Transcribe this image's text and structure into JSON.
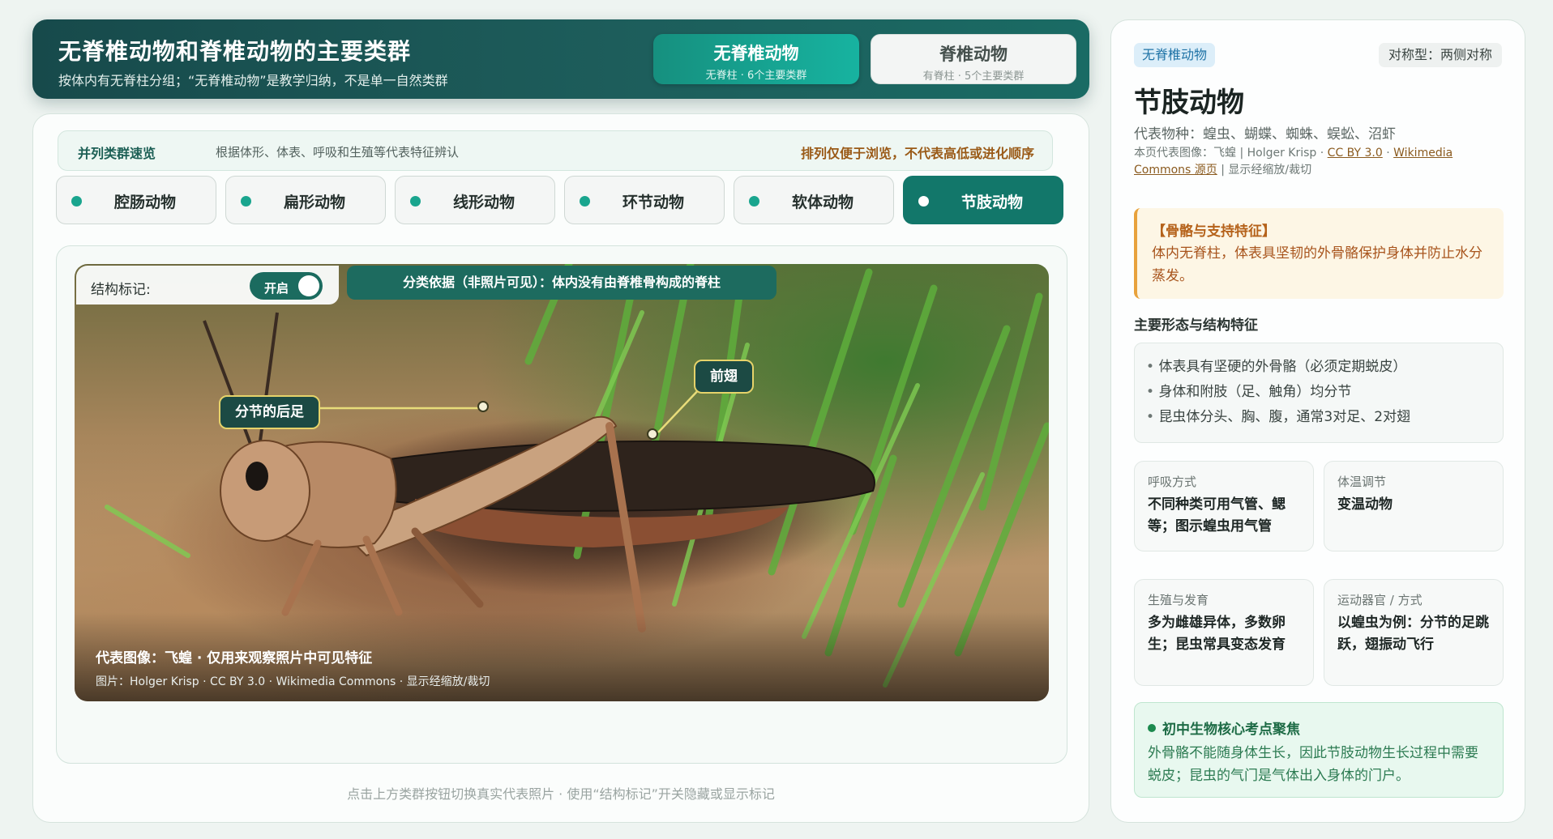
{
  "header": {
    "title": "无脊椎动物和脊椎动物的主要类群",
    "subtitle": "按体内有无脊柱分组；“无脊椎动物”是教学归纳，不是单一自然类群",
    "segments": [
      {
        "label": "无脊椎动物",
        "sub": "无脊柱 · 6个主要类群",
        "active": true
      },
      {
        "label": "脊椎动物",
        "sub": "有脊柱 · 5个主要类群",
        "active": false
      }
    ]
  },
  "overview": {
    "title": "并列类群速览",
    "desc": "根据体形、体表、呼吸和生殖等代表特征辨认",
    "note": "排列仅便于浏览，不代表高低或进化顺序"
  },
  "tabs": [
    {
      "label": "腔肠动物",
      "active": false
    },
    {
      "label": "扁形动物",
      "active": false
    },
    {
      "label": "线形动物",
      "active": false
    },
    {
      "label": "环节动物",
      "active": false
    },
    {
      "label": "软体动物",
      "active": false
    },
    {
      "label": "节肢动物",
      "active": true
    }
  ],
  "photo": {
    "toggle_label": "结构标记:",
    "toggle_state": "开启",
    "basis": "分类依据（非照片可见）：体内没有由脊椎骨构成的脊柱",
    "callouts": {
      "hind_leg": "分节的后足",
      "forewing": "前翅"
    },
    "caption_title": "代表图像：飞蝗 · 仅用来观察照片中可见特征",
    "caption_credit": "图片：Holger Krisp · CC BY 3.0 · Wikimedia Commons · 显示经缩放/裁切"
  },
  "footer_hint": "点击上方类群按钮切换真实代表照片 · 使用“结构标记”开关隐藏或显示标记",
  "side": {
    "group_badge": "无脊椎动物",
    "symmetry": "对称型：两侧对称",
    "title": "节肢动物",
    "species": "代表物种：蝗虫、蝴蝶、蜘蛛、蜈蚣、沼虾",
    "credit_prefix": "本页代表图像：飞蝗 | Holger Krisp · ",
    "credit_license": "CC BY 3.0",
    "credit_sep": " · ",
    "credit_source": "Wikimedia Commons 源页",
    "credit_suffix": " | 显示经缩放/裁切",
    "skeleton_title": "【骨骼与支持特征】",
    "skeleton_text": "体内无脊柱，体表具坚韧的外骨骼保护身体并防止水分蒸发。",
    "features_title": "主要形态与结构特征",
    "features": [
      "体表具有坚硬的外骨骼（必须定期蜕皮）",
      "身体和附肢（足、触角）均分节",
      "昆虫体分头、胸、腹，通常3对足、2对翅"
    ],
    "cards": [
      {
        "label": "呼吸方式",
        "value": "不同种类可用气管、鳃等；图示蝗虫用气管"
      },
      {
        "label": "体温调节",
        "value": "变温动物"
      },
      {
        "label": "生殖与发育",
        "value": "多为雌雄异体，多数卵生；昆虫常具变态发育"
      },
      {
        "label": "运动器官 / 方式",
        "value": "以蝗虫为例：分节的足跳跃，翅振动飞行"
      }
    ],
    "focus_title": "初中生物核心考点聚焦",
    "focus_text": "外骨骼不能随身体生长，因此节肢动物生长过程中需要蜕皮；昆虫的气门是气体出入身体的门户。"
  }
}
